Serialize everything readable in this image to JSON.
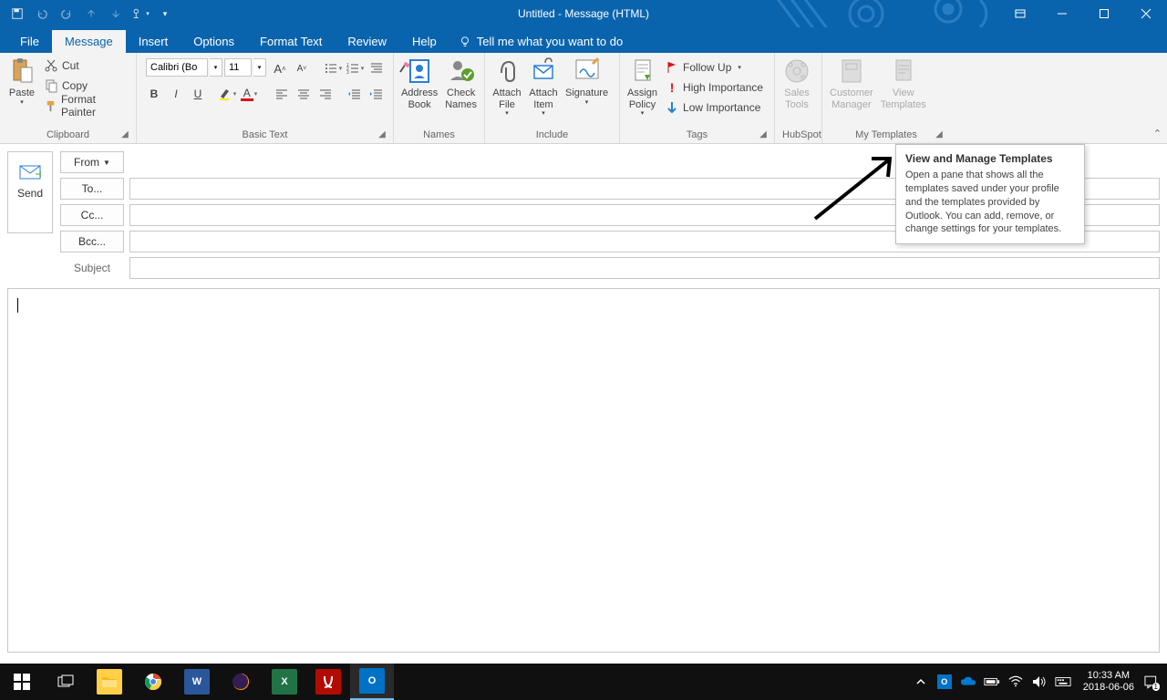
{
  "title": "Untitled  -  Message (HTML)",
  "tabs": {
    "file": "File",
    "message": "Message",
    "insert": "Insert",
    "options": "Options",
    "format": "Format Text",
    "review": "Review",
    "help": "Help",
    "tellme": "Tell me what you want to do"
  },
  "clipboard": {
    "paste": "Paste",
    "cut": "Cut",
    "copy": "Copy",
    "fp": "Format Painter",
    "label": "Clipboard"
  },
  "basictext": {
    "font": "Calibri (Bo",
    "size": "11",
    "label": "Basic Text"
  },
  "names": {
    "ab": "Address\nBook",
    "cn": "Check\nNames",
    "label": "Names"
  },
  "include": {
    "af": "Attach\nFile",
    "ai": "Attach\nItem",
    "sig": "Signature",
    "label": "Include"
  },
  "tags": {
    "assign": "Assign\nPolicy",
    "fu": "Follow Up",
    "hi": "High Importance",
    "lo": "Low Importance",
    "label": "Tags"
  },
  "hubspot": {
    "st": "Sales\nTools",
    "label": "HubSpot"
  },
  "templates": {
    "cm": "Customer\nManager",
    "vt": "View\nTemplates",
    "label": "My Templates"
  },
  "compose": {
    "send": "Send",
    "from": "From",
    "to": "To...",
    "cc": "Cc...",
    "bcc": "Bcc...",
    "subject": "Subject"
  },
  "tooltip": {
    "title": "View and Manage Templates",
    "body": "Open a pane that shows all the templates saved under your profile and the templates provided by Outlook. You can add, remove, or change settings for your templates."
  },
  "clock": {
    "time": "10:33 AM",
    "date": "2018-06-06"
  }
}
